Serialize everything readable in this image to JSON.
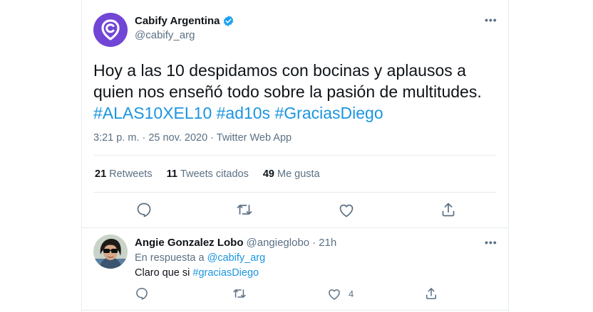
{
  "tweet": {
    "author_name": "Cabify Argentina",
    "author_handle": "@cabify_arg",
    "more_label": "•••",
    "text_line1": "Hoy a las 10 despidamos con bocinas y aplausos a",
    "text_line2": "quien nos enseñó todo sobre la pasión de multitudes.",
    "hashtags": "#ALAS10XEL10 #ad10s #GraciasDiego",
    "meta": "3:21 p. m. · 25 nov. 2020 · Twitter Web App",
    "stats": {
      "retweets_count": "21",
      "retweets_label": "Retweets",
      "quotes_count": "11",
      "quotes_label": "Tweets citados",
      "likes_count": "49",
      "likes_label": "Me gusta"
    }
  },
  "reply": {
    "author_name": "Angie Gonzalez Lobo",
    "author_handle": "@angieglobo",
    "separator": "·",
    "time": "21h",
    "more_label": "•••",
    "in_reply_prefix": "En respuesta a",
    "in_reply_handle": "@cabify_arg",
    "text_prefix": "Claro que si",
    "text_hashtag": "#graciasDiego",
    "like_count": "4"
  },
  "colors": {
    "brand_purple": "#7145d6",
    "link_blue": "#1b95e0",
    "verified_blue": "#1da1f2",
    "muted": "#5b7083"
  },
  "icons": [
    "cabify-logo-icon",
    "verified-badge-icon",
    "reply-icon",
    "retweet-icon",
    "like-icon",
    "share-icon"
  ]
}
